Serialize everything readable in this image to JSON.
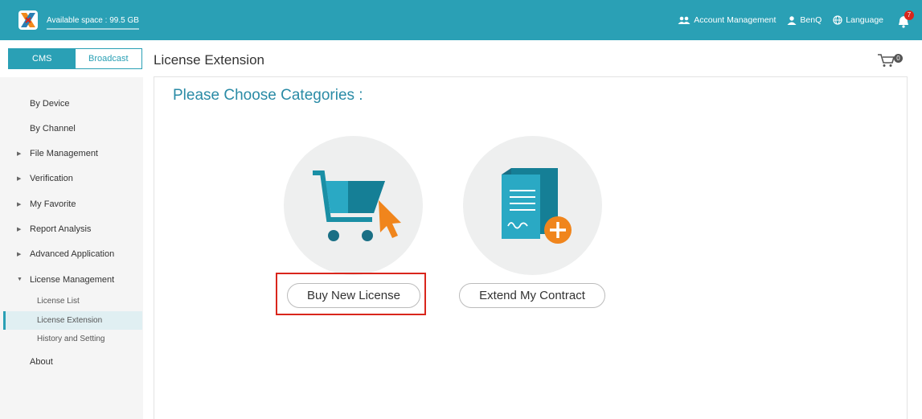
{
  "topbar": {
    "available_space": "Available space : 99.5 GB",
    "account_management": "Account Management",
    "user": "BenQ",
    "language": "Language",
    "notification_count": "7",
    "accent": "#2aa0b5"
  },
  "mode_tabs": [
    "CMS",
    "Broadcast"
  ],
  "sidebar": {
    "items": [
      {
        "label": "By Device"
      },
      {
        "label": "By Channel"
      },
      {
        "label": "File Management"
      },
      {
        "label": "Verification"
      },
      {
        "label": "My Favorite"
      },
      {
        "label": "Report Analysis"
      },
      {
        "label": "Advanced Application"
      },
      {
        "label": "License Management"
      },
      {
        "label": "About"
      }
    ],
    "license_sub": [
      "License List",
      "License Extension",
      "History and Setting"
    ]
  },
  "page": {
    "title": "License Extension",
    "cart_count": "0",
    "heading": "Please Choose Categories :",
    "options": [
      {
        "label": "Buy New License",
        "icon": "cart-icon"
      },
      {
        "label": "Extend My Contract",
        "icon": "contract-add-icon"
      }
    ]
  }
}
